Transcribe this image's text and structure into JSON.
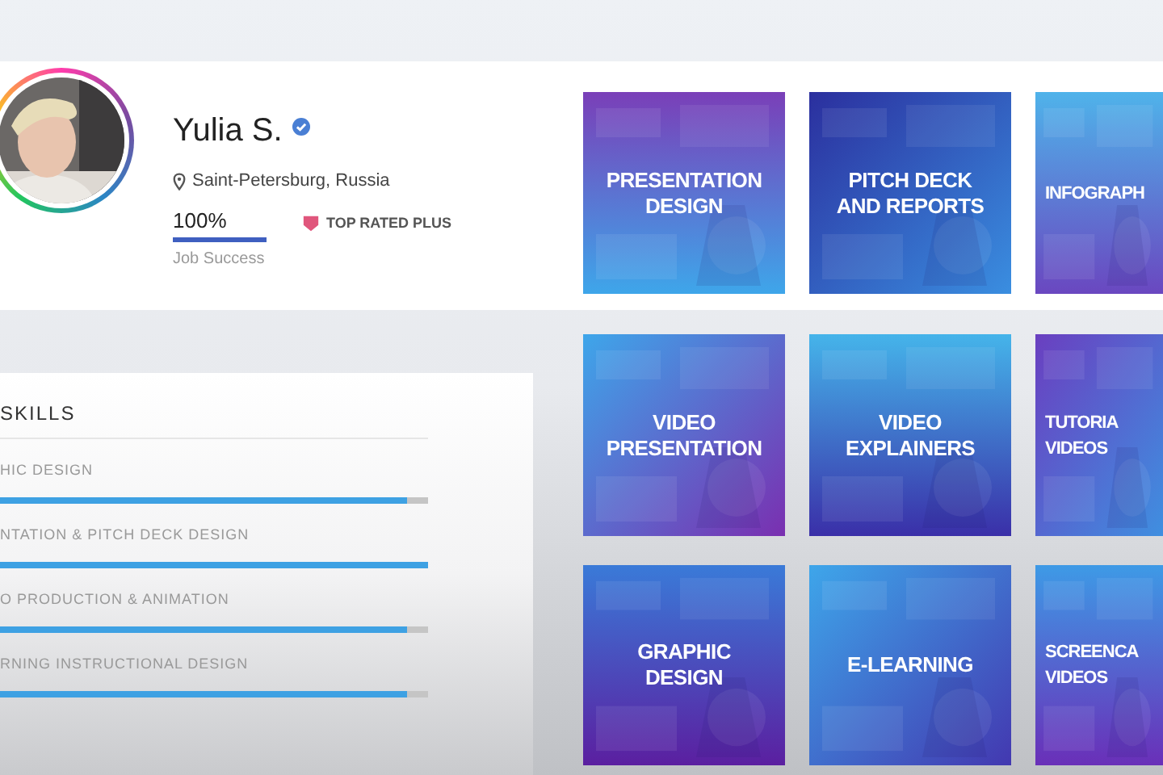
{
  "profile": {
    "name": "Yulia S.",
    "verified": true,
    "location": "Saint-Petersburg, Russia",
    "job_success": {
      "value": "100%",
      "level": 1,
      "label": "Job Success"
    },
    "badge": "TOP RATED PLUS"
  },
  "skills": {
    "title": "SKILLS",
    "items": [
      {
        "name": "HIC DESIGN",
        "level": 0.95
      },
      {
        "name": "NTATION & PITCH DECK DESIGN",
        "level": 1
      },
      {
        "name": "O PRODUCTION & ANIMATION",
        "level": 0.95
      },
      {
        "name": "RNING INSTRUCTIONAL DESIGN",
        "level": 0.95
      }
    ]
  },
  "services": [
    {
      "lines": [
        "PRESENTATION",
        "DESIGN"
      ]
    },
    {
      "lines": [
        "PITCH DECK",
        "AND REPORTS"
      ]
    },
    {
      "lines": [
        "INFOGRAPH"
      ]
    },
    {
      "lines": [
        "VIDEO",
        "PRESENTATION"
      ]
    },
    {
      "lines": [
        "VIDEO",
        "EXPLAINERS"
      ]
    },
    {
      "lines": [
        "TUTORIA",
        "VIDEOS"
      ]
    },
    {
      "lines": [
        "GRAPHIC",
        "DESIGN"
      ]
    },
    {
      "lines": [
        "E-LEARNING"
      ]
    },
    {
      "lines": [
        "SCREENCA",
        "VIDEOS"
      ]
    }
  ]
}
